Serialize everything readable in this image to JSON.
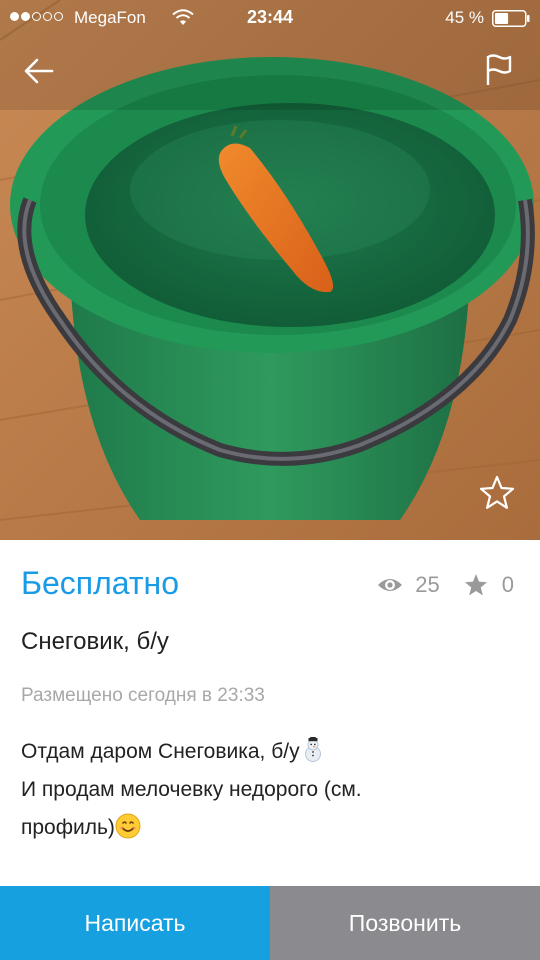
{
  "status_bar": {
    "carrier": "MegaFon",
    "time": "23:44",
    "battery_percent": "45 %",
    "signal_bars_filled": 2,
    "signal_bars_total": 5,
    "battery_level": 0.45
  },
  "listing": {
    "price": "Бесплатно",
    "views": "25",
    "favorites": "0",
    "title": "Снеговик, б/у",
    "posted": "Размещено сегодня в 23:33",
    "description_lines": [
      "Отдам даром Снеговика, б/у",
      "И продам мелочевку недорого (см.",
      "профиль)"
    ]
  },
  "icons": {
    "back": "arrow-left-icon",
    "flag": "flag-icon",
    "favorite": "star-outline-icon",
    "views": "eye-icon",
    "favorites_count": "star-icon",
    "snowman": "snowman-emoji",
    "smile": "smile-emoji"
  },
  "actions": {
    "write_label": "Написать",
    "call_label": "Позвонить"
  },
  "colors": {
    "accent": "#1a9be6",
    "write_button": "#16a0e0",
    "call_button": "#8a8a8f",
    "muted_text": "#a8a8a8"
  }
}
